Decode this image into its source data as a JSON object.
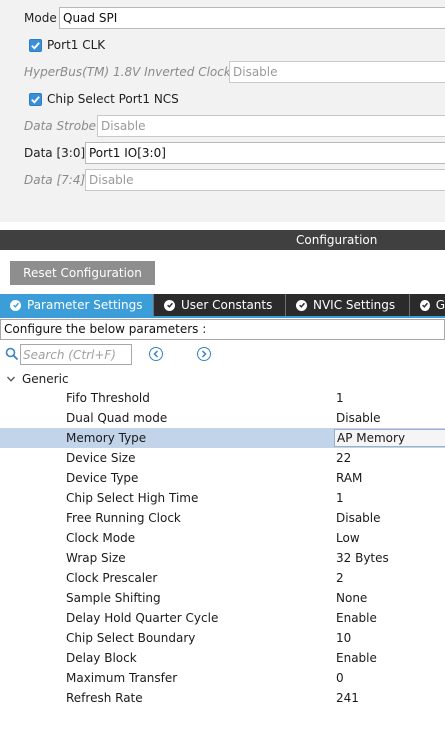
{
  "mode_panel": {
    "mode_label": "Mode",
    "mode_value": "Quad SPI",
    "port1_clk_label": "Port1 CLK",
    "port1_clk_checked": true,
    "hyperbus_label": "HyperBus(TM) 1.8V Inverted Clock",
    "hyperbus_value": "Disable",
    "chip_select_label": "Chip Select Port1 NCS",
    "chip_select_checked": true,
    "data_strobe_label": "Data Strobe",
    "data_strobe_value": "Disable",
    "data_3_0_label": "Data [3:0]",
    "data_3_0_value": "Port1 IO[3:0]",
    "data_7_4_label": "Data [7:4]",
    "data_7_4_value": "Disable"
  },
  "configuration": {
    "title": "Configuration",
    "reset_button": "Reset Configuration",
    "tabs": [
      {
        "label": "Parameter Settings",
        "active": true
      },
      {
        "label": "User Constants",
        "active": false
      },
      {
        "label": "NVIC Settings",
        "active": false
      },
      {
        "label": "G",
        "active": false
      }
    ],
    "configure_text": "Configure the below parameters :",
    "search_placeholder": "Search (Ctrl+F)",
    "group_label": "Generic",
    "parameters": [
      {
        "name": "Fifo Threshold",
        "value": "1"
      },
      {
        "name": "Dual Quad mode",
        "value": "Disable"
      },
      {
        "name": "Memory Type",
        "value": "AP Memory",
        "selected": true
      },
      {
        "name": "Device Size",
        "value": "22"
      },
      {
        "name": "Device Type",
        "value": "RAM"
      },
      {
        "name": "Chip Select High Time",
        "value": "1"
      },
      {
        "name": "Free Running Clock",
        "value": "Disable"
      },
      {
        "name": "Clock Mode",
        "value": "Low"
      },
      {
        "name": "Wrap Size",
        "value": "32 Bytes"
      },
      {
        "name": "Clock Prescaler",
        "value": "2"
      },
      {
        "name": "Sample Shifting",
        "value": "None"
      },
      {
        "name": "Delay Hold Quarter Cycle",
        "value": "Enable"
      },
      {
        "name": "Chip Select Boundary",
        "value": "10"
      },
      {
        "name": "Delay Block",
        "value": "Enable"
      },
      {
        "name": "Maximum Transfer",
        "value": "0"
      },
      {
        "name": "Refresh Rate",
        "value": "241"
      }
    ]
  },
  "colors": {
    "accent": "#3c9ed8",
    "selected_row": "#c2d4ea",
    "tab_bar": "#2b2b2b"
  }
}
